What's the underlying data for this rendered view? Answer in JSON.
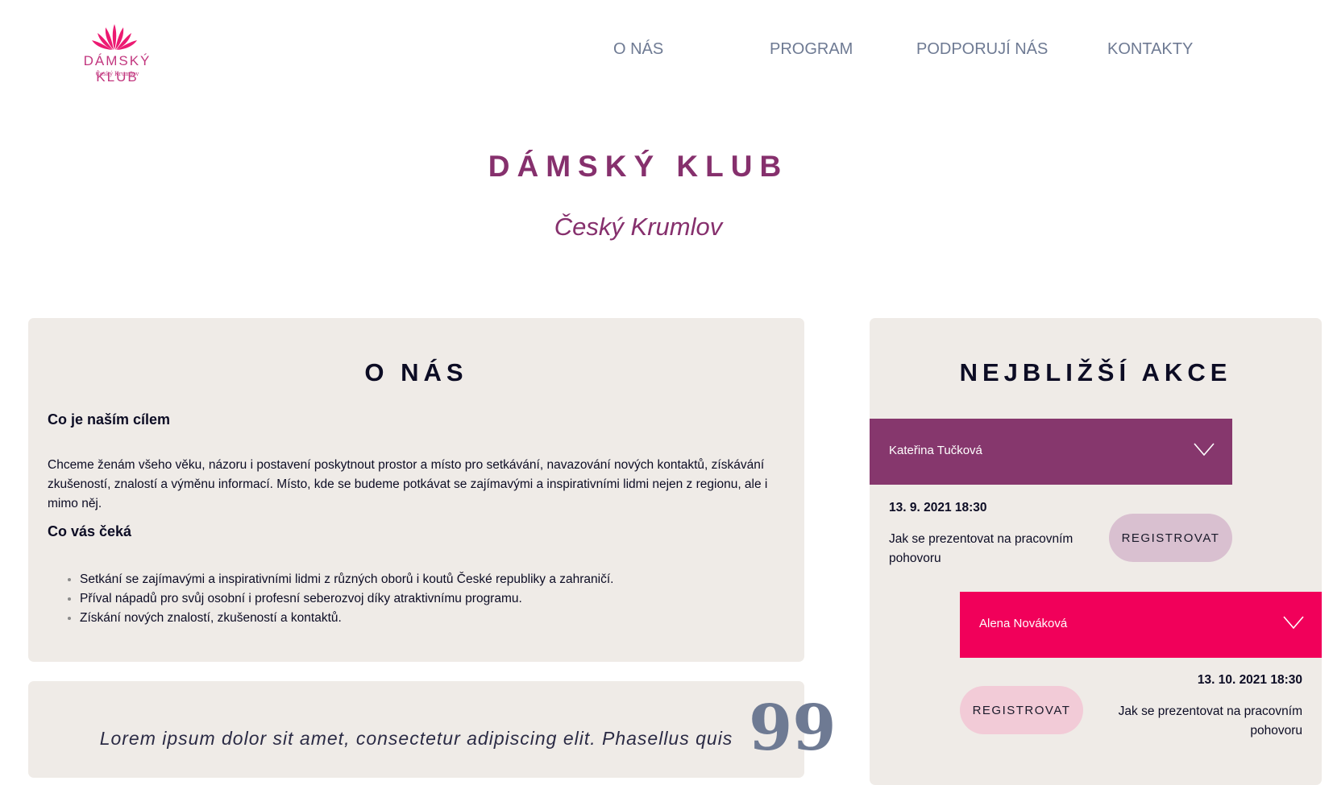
{
  "brand": {
    "name": "DÁMSKÝ KLUB",
    "subtitle": "Český Krumlov",
    "accent": "#c2377f"
  },
  "nav": {
    "items": [
      "O NÁS",
      "PROGRAM",
      "PODPORUJÍ NÁS",
      "KONTAKTY"
    ],
    "color": "#6e7a93"
  },
  "hero": {
    "title": "DÁMSKÝ KLUB",
    "subtitle": "Český Krumlov",
    "color": "#86306d"
  },
  "about": {
    "title": "O NÁS",
    "goal_heading": "Co je naším cílem",
    "goal_text": "Chceme ženám všeho věku, názoru i postavení poskytnout prostor a místo pro setkávání, navazování nových kontaktů, získávání zkušeností, znalostí a výměnu informací. Místo, kde se budeme potkávat se zajímavými a inspirativními lidmi nejen z regionu, ale i mimo něj.",
    "expect_heading": "Co vás čeká",
    "expect_items": [
      "Setkání se zajímavými a inspirativními lidmi z různých oborů i koutů České republiky a zahraničí.",
      "Příval nápadů pro svůj osobní i profesní seberozvoj díky atraktivnímu programu.",
      "Získání nových znalostí, zkušeností a kontaktů."
    ]
  },
  "quote": {
    "mark": "99",
    "text": "Lorem ipsum dolor sit amet, consectetur adipiscing elit. Phasellus quis"
  },
  "events": {
    "title": "NEJBLIŽŠÍ AKCE",
    "items": [
      {
        "speaker": "Kateřina Tučková",
        "date": "13. 9. 2021 18:30",
        "description": "Jak se prezentovat na pracovním pohovoru",
        "button": "REGISTROVAT",
        "bar_color": "#86376d",
        "button_color": "#d9c0d0"
      },
      {
        "speaker": "Alena Nováková",
        "date": "13. 10. 2021 18:30",
        "description": "Jak se prezentovat na pracovním pohovoru",
        "button": "REGISTROVAT",
        "bar_color": "#f1005a",
        "button_color": "#f2cbd7"
      }
    ]
  },
  "colors": {
    "card_bg": "#efebe7",
    "text": "#0c0c24"
  }
}
